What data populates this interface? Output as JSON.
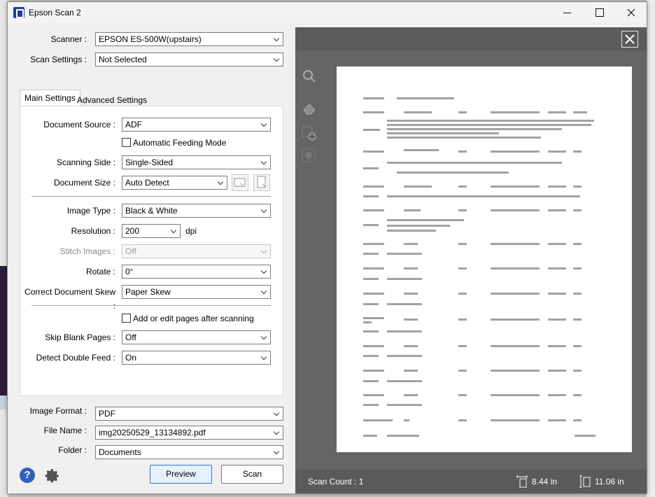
{
  "window": {
    "title": "Epson Scan 2"
  },
  "scanner": {
    "label": "Scanner :",
    "value": "EPSON ES-500W(upstairs)"
  },
  "scan_settings": {
    "label": "Scan Settings :",
    "value": "Not Selected"
  },
  "tabs": {
    "main": "Main Settings",
    "advanced": "Advanced Settings"
  },
  "main": {
    "document_source": {
      "label": "Document Source :",
      "value": "ADF"
    },
    "automatic_feeding": {
      "label": "Automatic Feeding Mode"
    },
    "scanning_side": {
      "label": "Scanning Side :",
      "value": "Single-Sided"
    },
    "document_size": {
      "label": "Document Size :",
      "value": "Auto Detect"
    },
    "image_type": {
      "label": "Image Type :",
      "value": "Black & White"
    },
    "resolution": {
      "label": "Resolution :",
      "value": "200",
      "unit": "dpi"
    },
    "stitch_images": {
      "label": "Stitch Images :",
      "value": "Off"
    },
    "rotate": {
      "label": "Rotate :",
      "value": "0°"
    },
    "correct_skew": {
      "label": "Correct Document Skew :",
      "value": "Paper Skew"
    },
    "add_edit_pages": {
      "label": "Add or edit pages after scanning"
    },
    "skip_blank": {
      "label": "Skip Blank Pages :",
      "value": "Off"
    },
    "double_feed": {
      "label": "Detect Double Feed :",
      "value": "On"
    }
  },
  "output": {
    "image_format": {
      "label": "Image Format :",
      "value": "PDF"
    },
    "file_name": {
      "label": "File Name :",
      "value": "img20250529_13134892.pdf"
    },
    "folder": {
      "label": "Folder :",
      "value": "Documents"
    }
  },
  "buttons": {
    "preview": "Preview",
    "scan": "Scan",
    "help": "?"
  },
  "preview": {
    "scan_count": "Scan Count : 1",
    "width": "8.44 in",
    "height": "11.06 in"
  }
}
